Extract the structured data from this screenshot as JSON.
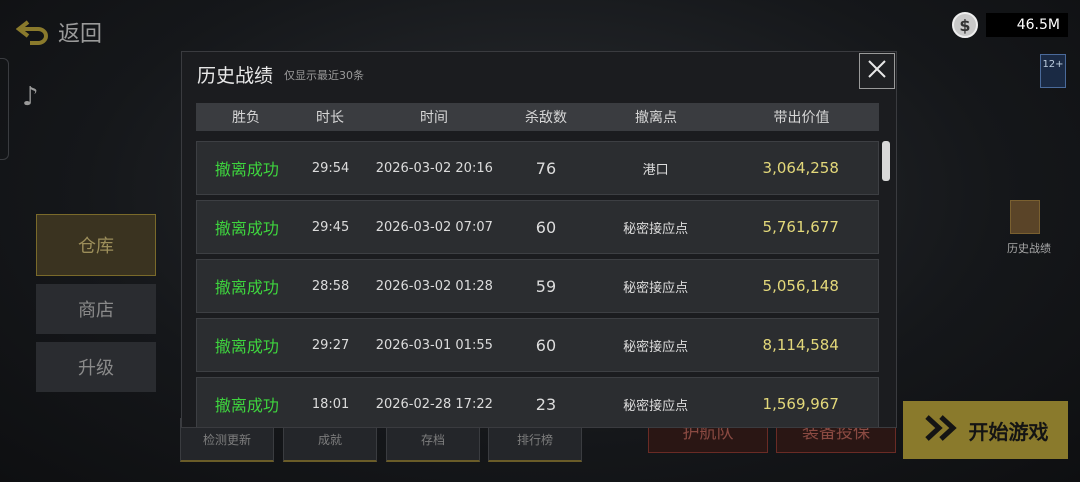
{
  "top": {
    "back_label": "返回",
    "money": "46.5M",
    "coin_symbol": "$",
    "age_rating": "12+"
  },
  "side_menu": [
    {
      "label": "仓库",
      "active": true
    },
    {
      "label": "商店",
      "active": false
    },
    {
      "label": "升级",
      "active": false
    }
  ],
  "bottom_bar": [
    "检测更新",
    "成就",
    "存档",
    "排行榜"
  ],
  "right_actions": {
    "history_label": "历史战绩",
    "escort": "护航队",
    "insure": "装备投保",
    "start": "开始游戏"
  },
  "modal": {
    "title": "历史战绩",
    "subtitle": "仅显示最近30条",
    "columns": [
      "胜负",
      "时长",
      "时间",
      "杀敌数",
      "撤离点",
      "带出价值"
    ],
    "rows": [
      {
        "result": "撤离成功",
        "duration": "29:54",
        "time": "2026-03-02 20:16",
        "kills": "76",
        "exit": "港口",
        "value": "3,064,258"
      },
      {
        "result": "撤离成功",
        "duration": "29:45",
        "time": "2026-03-02 07:07",
        "kills": "60",
        "exit": "秘密接应点",
        "value": "5,761,677"
      },
      {
        "result": "撤离成功",
        "duration": "28:58",
        "time": "2026-03-02 01:28",
        "kills": "59",
        "exit": "秘密接应点",
        "value": "5,056,148"
      },
      {
        "result": "撤离成功",
        "duration": "29:27",
        "time": "2026-03-01 01:55",
        "kills": "60",
        "exit": "秘密接应点",
        "value": "8,114,584"
      },
      {
        "result": "撤离成功",
        "duration": "18:01",
        "time": "2026-02-28 17:22",
        "kills": "23",
        "exit": "秘密接应点",
        "value": "1,569,967"
      }
    ]
  },
  "colors": {
    "success": "#3ed43e",
    "value": "#e3d87a",
    "accent": "#8a7a2c"
  }
}
